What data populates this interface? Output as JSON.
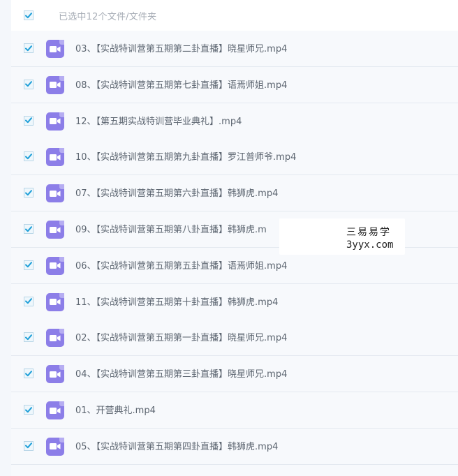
{
  "header": {
    "select_all_checked": true,
    "selection_text": "已选中12个文件/文件夹"
  },
  "files": [
    {
      "name": "03、【实战特训营第五期第二卦直播】晓星师兄.mp4",
      "checked": true,
      "icon": "video-file-icon"
    },
    {
      "name": "08、【实战特训营第五期第七卦直播】语焉师姐.mp4",
      "checked": true,
      "icon": "video-file-icon"
    },
    {
      "name": "12、【第五期实战特训营毕业典礼】.mp4",
      "checked": true,
      "icon": "video-file-icon"
    },
    {
      "name": "10、【实战特训营第五期第九卦直播】罗江普师爷.mp4",
      "checked": true,
      "icon": "video-file-icon"
    },
    {
      "name": "07、【实战特训营第五期第六卦直播】韩狮虎.mp4",
      "checked": true,
      "icon": "video-file-icon"
    },
    {
      "name": "09、【实战特训营第五期第八卦直播】韩狮虎.m",
      "checked": true,
      "icon": "video-file-icon"
    },
    {
      "name": "06、【实战特训营第五期第五卦直播】语焉师姐.mp4",
      "checked": true,
      "icon": "video-file-icon"
    },
    {
      "name": "11、【实战特训营第五期第十卦直播】韩狮虎.mp4",
      "checked": true,
      "icon": "video-file-icon"
    },
    {
      "name": "02、【实战特训营第五期第一卦直播】晓星师兄.mp4",
      "checked": true,
      "icon": "video-file-icon"
    },
    {
      "name": "04、【实战特训营第五期第三卦直播】晓星师兄.mp4",
      "checked": true,
      "icon": "video-file-icon"
    },
    {
      "name": "01、开营典礼.mp4",
      "checked": true,
      "icon": "video-file-icon"
    },
    {
      "name": "05、【实战特训营第五期第四卦直播】韩狮虎.mp4",
      "checked": true,
      "icon": "video-file-icon"
    }
  ],
  "watermark": {
    "name": "三易易学",
    "url": "3yyx.com"
  },
  "colors": {
    "checkbox_tick": "#1f9fd8",
    "icon_purple": "#8c7ee8",
    "text": "#5c6570",
    "header_text": "#a7adb6"
  }
}
